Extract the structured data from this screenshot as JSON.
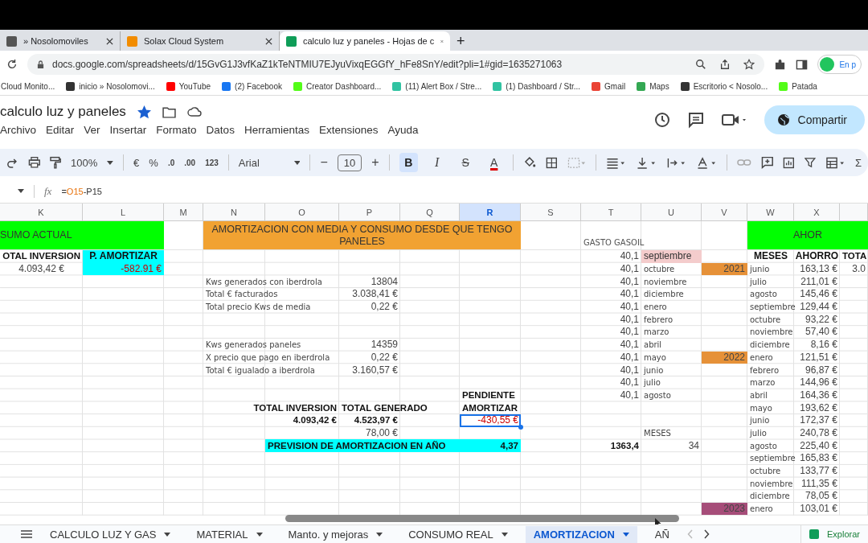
{
  "browser": {
    "tabs": [
      {
        "title": "» Nosolomoviles",
        "selected": false,
        "color": "#555555"
      },
      {
        "title": "Solax Cloud System",
        "selected": false,
        "color": "#f28c00"
      },
      {
        "title": "calculo luz y paneles - Hojas de c",
        "selected": true,
        "color": "#0f9d58"
      }
    ],
    "new_tab": "+",
    "url": "docs.google.com/spreadsheets/d/15GvG1J3vfKaZ1kTeNTMIU7EJyuVixqEGGfY_hFe8SnY/edit?pli=1#gid=1635271063",
    "profile": "En p",
    "bookmarks": [
      {
        "label": "Cloud Monito..."
      },
      {
        "label": "inicio » Nosolomovi...",
        "color": "#333333"
      },
      {
        "label": "YouTube",
        "color": "#ff0000"
      },
      {
        "label": "(2) Facebook",
        "color": "#1877f2"
      },
      {
        "label": "Creator Dashboard...",
        "color": "#53fc18"
      },
      {
        "label": "(11) Alert Box / Stre...",
        "color": "#31c3a2"
      },
      {
        "label": "(1) Dashboard / Str...",
        "color": "#31c3a2"
      },
      {
        "label": "Gmail",
        "color": "#ea4335"
      },
      {
        "label": "Maps",
        "color": "#34a853"
      },
      {
        "label": "Escritorio < Nosolo...",
        "color": "#333333"
      },
      {
        "label": "Patada",
        "color": "#53fc18"
      }
    ]
  },
  "doc": {
    "title": "calculo luz y paneles",
    "starred": true,
    "menus": [
      "Archivo",
      "Editar",
      "Ver",
      "Insertar",
      "Formato",
      "Datos",
      "Herramientas",
      "Extensiones",
      "Ayuda"
    ],
    "share": "Compartir"
  },
  "toolbar": {
    "zoom": "100%",
    "currency": "€",
    "percent": "%",
    "decimal_decrease": ".0",
    "decimal_increase": ".00",
    "number_format": "123",
    "font": "Arial",
    "minus": "−",
    "font_size": "10",
    "plus": "+",
    "bold": "B",
    "bold_selected": true,
    "italic": "I",
    "strikethrough": "S",
    "text_color": "A",
    "sum": "Σ"
  },
  "formula_bar": {
    "function_label": "fx",
    "parts": [
      {
        "text": "=",
        "kind": "op"
      },
      {
        "text": "O15",
        "kind": "ref"
      },
      {
        "text": "-P15",
        "kind": "op"
      }
    ]
  },
  "columns": [
    {
      "letter": "K",
      "selected": false
    },
    {
      "letter": "L",
      "selected": false
    },
    {
      "letter": "M",
      "selected": false
    },
    {
      "letter": "N",
      "selected": false
    },
    {
      "letter": "O",
      "selected": false
    },
    {
      "letter": "P",
      "selected": false
    },
    {
      "letter": "Q",
      "selected": false
    },
    {
      "letter": "R",
      "selected": true
    },
    {
      "letter": "S",
      "selected": false
    },
    {
      "letter": "T",
      "selected": false
    },
    {
      "letter": "U",
      "selected": false
    },
    {
      "letter": "V",
      "selected": false
    },
    {
      "letter": "W",
      "selected": false
    },
    {
      "letter": "X",
      "selected": false
    }
  ],
  "band": {
    "K": {
      "text": "SUMO ACTUAL",
      "kind": "banner",
      "color": "#00ff00"
    },
    "L": {
      "kind": "merged"
    },
    "N": {
      "text": "AMORTIZACION CON MEDIA Y CONSUMO DESDE QUE TENGO PANELES",
      "kind": "title",
      "color": "#f1a232"
    },
    "O": {
      "kind": "merged"
    },
    "P": {
      "kind": "merged"
    },
    "Q": {
      "kind": "merged"
    },
    "R": {
      "kind": "merged"
    },
    "T": {
      "text": "GASTO GASOIL",
      "kind": "caption"
    },
    "W": {
      "text": "AHOR",
      "kind": "title",
      "color": "#00ff00"
    },
    "X": {
      "kind": "merged"
    },
    "edge": {
      "kind": "merged"
    }
  },
  "rows": [
    {
      "K": {
        "text": "OTAL INVERSION",
        "kind": "total"
      },
      "L": {
        "text": "P. AMORTIZAR",
        "kind": "heading",
        "color": "#00ffff"
      },
      "T": {
        "text": "40,1",
        "kind": "value"
      },
      "U": {
        "text": "septiembre",
        "kind": "plain",
        "color": "#f4cccc"
      },
      "W": {
        "text": "MESES",
        "kind": "heading"
      },
      "X": {
        "text": "AHORRO",
        "kind": "heading"
      },
      "edge": {
        "text": "TOTA",
        "kind": "bold"
      }
    },
    {
      "K": {
        "text": "4.093,42 €",
        "kind": "centered"
      },
      "L": {
        "text": "-582.91 €",
        "kind": "negative",
        "color": "#00ffff"
      },
      "T": {
        "text": "40,1",
        "kind": "value"
      },
      "U": {
        "text": "octubre",
        "kind": "label"
      },
      "V": {
        "text": "2021",
        "kind": "value",
        "color": "#e69138"
      },
      "W": {
        "text": "junio",
        "kind": "label"
      },
      "X": {
        "text": "163,13 €",
        "kind": "value"
      },
      "edge": {
        "text": "3.0",
        "kind": "value"
      }
    },
    {
      "N": {
        "text": "Kws generados con iberdrola",
        "kind": "label"
      },
      "P": {
        "text": "13804",
        "kind": "value"
      },
      "T": {
        "text": "40,1",
        "kind": "value"
      },
      "U": {
        "text": "noviembre",
        "kind": "label"
      },
      "W": {
        "text": "julio",
        "kind": "label"
      },
      "X": {
        "text": "211,01 €",
        "kind": "value"
      }
    },
    {
      "N": {
        "text": "Total € facturados",
        "kind": "label"
      },
      "P": {
        "text": "3.038,41 €",
        "kind": "value"
      },
      "T": {
        "text": "40,1",
        "kind": "value"
      },
      "U": {
        "text": "diciembre",
        "kind": "label"
      },
      "W": {
        "text": "agosto",
        "kind": "label"
      },
      "X": {
        "text": "145,46 €",
        "kind": "value"
      }
    },
    {
      "N": {
        "text": "Total precio Kws de media",
        "kind": "label"
      },
      "P": {
        "text": "0,22 €",
        "kind": "value"
      },
      "T": {
        "text": "40,1",
        "kind": "value"
      },
      "U": {
        "text": "enero",
        "kind": "label"
      },
      "W": {
        "text": "septiembre",
        "kind": "label"
      },
      "X": {
        "text": "129,44 €",
        "kind": "value"
      }
    },
    {
      "T": {
        "text": "40,1",
        "kind": "value"
      },
      "U": {
        "text": "febrero",
        "kind": "label"
      },
      "W": {
        "text": "octubre",
        "kind": "label"
      },
      "X": {
        "text": "93,22 €",
        "kind": "value"
      }
    },
    {
      "T": {
        "text": "40,1",
        "kind": "value"
      },
      "U": {
        "text": "marzo",
        "kind": "label"
      },
      "W": {
        "text": "noviembre",
        "kind": "label"
      },
      "X": {
        "text": "57,40 €",
        "kind": "value"
      }
    },
    {
      "N": {
        "text": "Kws generados paneles",
        "kind": "label"
      },
      "P": {
        "text": "14359",
        "kind": "value"
      },
      "T": {
        "text": "40,1",
        "kind": "value"
      },
      "U": {
        "text": "abril",
        "kind": "label"
      },
      "W": {
        "text": "diciembre",
        "kind": "label"
      },
      "X": {
        "text": "8,16 €",
        "kind": "value"
      }
    },
    {
      "N": {
        "text": "X precio que pago en iberdrola",
        "kind": "label"
      },
      "P": {
        "text": "0,22 €",
        "kind": "value"
      },
      "T": {
        "text": "40,1",
        "kind": "value"
      },
      "U": {
        "text": "mayo",
        "kind": "label"
      },
      "V": {
        "text": "2022",
        "kind": "value",
        "color": "#e69138"
      },
      "W": {
        "text": "enero",
        "kind": "label"
      },
      "X": {
        "text": "121,51 €",
        "kind": "value"
      }
    },
    {
      "N": {
        "text": "Total € igualado a iberdrola",
        "kind": "label"
      },
      "P": {
        "text": "3.160,57 €",
        "kind": "value"
      },
      "T": {
        "text": "40,1",
        "kind": "value"
      },
      "U": {
        "text": "junio",
        "kind": "label"
      },
      "W": {
        "text": "febrero",
        "kind": "label"
      },
      "X": {
        "text": "96,87 €",
        "kind": "value"
      }
    },
    {
      "T": {
        "text": "40,1",
        "kind": "value"
      },
      "U": {
        "text": "julio",
        "kind": "label"
      },
      "W": {
        "text": "marzo",
        "kind": "label"
      },
      "X": {
        "text": "144,96 €",
        "kind": "value"
      }
    },
    {
      "R": {
        "text": "PENDIENTE",
        "kind": "bold"
      },
      "T": {
        "text": "40,1",
        "kind": "value"
      },
      "U": {
        "text": "agosto",
        "kind": "label"
      },
      "W": {
        "text": "abril",
        "kind": "label"
      },
      "X": {
        "text": "164,36 €",
        "kind": "value"
      }
    },
    {
      "O": {
        "text": "TOTAL INVERSION",
        "kind": "total"
      },
      "P": {
        "text": "TOTAL GENERADO",
        "kind": "bold"
      },
      "R": {
        "text": "AMORTIZAR",
        "kind": "bold"
      },
      "W": {
        "text": "mayo",
        "kind": "label"
      },
      "X": {
        "text": "193,62 €",
        "kind": "value"
      }
    },
    {
      "O": {
        "text": "4.093,42 €",
        "kind": "total"
      },
      "P": {
        "text": "4.523,97 €",
        "kind": "total"
      },
      "R": {
        "text": "-430,55 €",
        "kind": "negative",
        "selected": true
      },
      "W": {
        "text": "junio",
        "kind": "label"
      },
      "X": {
        "text": "172,37 €",
        "kind": "value"
      }
    },
    {
      "P": {
        "text": "78,00 €",
        "kind": "value"
      },
      "U": {
        "text": "MESES",
        "kind": "label"
      },
      "W": {
        "text": "julio",
        "kind": "label"
      },
      "X": {
        "text": "240,78 €",
        "kind": "value"
      }
    },
    {
      "O": {
        "text": "PREVISION DE AMORTIZACION EN AÑO",
        "kind": "bold",
        "color": "#00ffff"
      },
      "P": {
        "kind": "merged"
      },
      "Q": {
        "kind": "merged"
      },
      "R": {
        "text": "4,37",
        "kind": "total",
        "color": "#00ffff"
      },
      "T": {
        "text": "1363,4",
        "kind": "total"
      },
      "U": {
        "text": "34",
        "kind": "value"
      },
      "W": {
        "text": "agosto",
        "kind": "label"
      },
      "X": {
        "text": "225,40 €",
        "kind": "value"
      }
    },
    {
      "W": {
        "text": "septiembre",
        "kind": "label"
      },
      "X": {
        "text": "165,83 €",
        "kind": "value"
      }
    },
    {
      "W": {
        "text": "octubre",
        "kind": "label"
      },
      "X": {
        "text": "133,77 €",
        "kind": "value"
      }
    },
    {
      "W": {
        "text": "noviembre",
        "kind": "label"
      },
      "X": {
        "text": "111,35 €",
        "kind": "value"
      }
    },
    {
      "W": {
        "text": "diciembre",
        "kind": "label"
      },
      "X": {
        "text": "78,05 €",
        "kind": "value"
      }
    },
    {
      "V": {
        "text": "2023",
        "kind": "value",
        "color": "#a64d79"
      },
      "W": {
        "text": "enero",
        "kind": "label"
      },
      "X": {
        "text": "103,01 €",
        "kind": "value"
      }
    }
  ],
  "sheet_tabs": [
    {
      "label": "CALCULO LUZ Y GAS",
      "selected": false
    },
    {
      "label": "MATERIAL",
      "selected": false
    },
    {
      "label": "Manto. y mejoras",
      "selected": false
    },
    {
      "label": "CONSUMO REAL",
      "selected": false
    },
    {
      "label": "AMORTIZACION",
      "selected": true
    },
    {
      "label": "AÑ",
      "selected": false
    }
  ],
  "explore": "Explorar"
}
